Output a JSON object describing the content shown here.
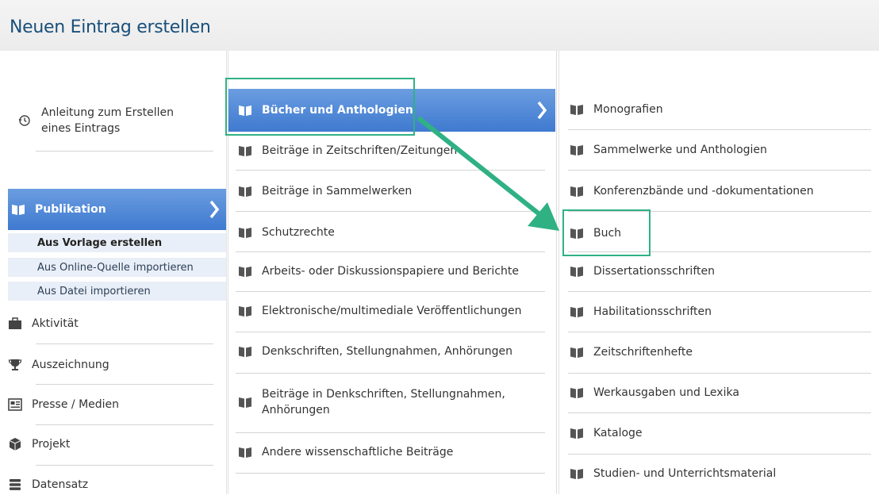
{
  "header": {
    "title": "Neuen Eintrag erstellen"
  },
  "col1": {
    "guide": "Anleitung zum Erstellen eines Eintrags",
    "publication": "Publikation",
    "subitems": [
      "Aus Vorlage erstellen",
      "Aus Online-Quelle importieren",
      "Aus Datei importieren"
    ],
    "items": [
      "Aktivität",
      "Auszeichnung",
      "Presse / Medien",
      "Projekt",
      "Datensatz"
    ]
  },
  "col2": {
    "items": [
      "Bücher und Anthologien",
      "Beiträge in Zeitschriften/Zeitungen",
      "Beiträge in Sammelwerken",
      "Schutzrechte",
      "Arbeits- oder Diskussionspapiere und Berichte",
      "Elektronische/multimediale Veröffentlichungen",
      "Denkschriften, Stellungnahmen, Anhörungen",
      "Beiträge in Denkschriften, Stellungnahmen, Anhörungen",
      "Andere wissenschaftliche Beiträge"
    ]
  },
  "col3": {
    "items": [
      "Monografien",
      "Sammelwerke und Anthologien",
      "Konferenzbände und -dokumentationen",
      "Buch",
      "Dissertationsschriften",
      "Habilitationsschriften",
      "Zeitschriftenhefte",
      "Werkausgaben und Lexika",
      "Kataloge",
      "Studien- und Unterrichtsmaterial"
    ]
  },
  "colors": {
    "active": "#4a85d6",
    "highlight": "#2fb184",
    "title": "#1a4f7a"
  }
}
